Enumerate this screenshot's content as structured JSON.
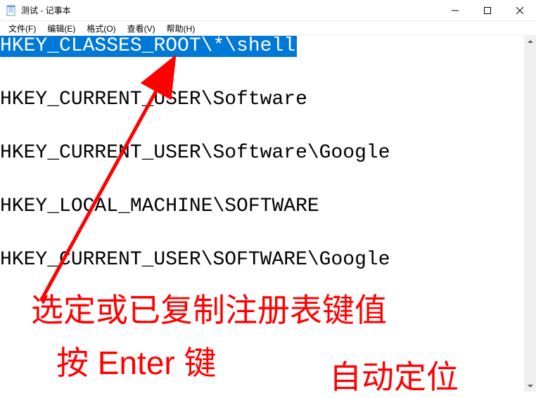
{
  "window": {
    "title": "测试 - 记事本"
  },
  "menu": {
    "file": "文件(F)",
    "edit": "编辑(E)",
    "format": "格式(O)",
    "view": "查看(V)",
    "help": "帮助(H)"
  },
  "content": {
    "line1": "HKEY_CLASSES_ROOT\\*\\shell",
    "line2": "HKEY_CURRENT_USER\\Software",
    "line3": "HKEY_CURRENT_USER\\Software\\Google",
    "line4": "HKEY_LOCAL_MACHINE\\SOFTWARE",
    "line5": "HKEY_CURRENT_USER\\SOFTWARE\\Google"
  },
  "annotation": {
    "text1": "选定或已复制注册表键值",
    "text2": "按 Enter 键",
    "text3": "自动定位"
  },
  "colors": {
    "selection_bg": "#0078d7",
    "selection_fg": "#ffffff",
    "annotation": "#ff0000"
  }
}
